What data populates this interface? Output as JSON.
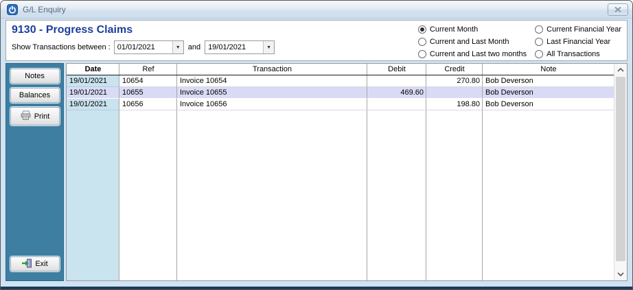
{
  "window": {
    "title": "G/L Enquiry"
  },
  "header": {
    "title": "9130 - Progress Claims"
  },
  "filters": {
    "label": "Show Transactions between :",
    "from_value": "01/01/2021",
    "conjunction": "and",
    "to_value": "19/01/2021",
    "radio_options": [
      {
        "label": "Current Month",
        "selected": true
      },
      {
        "label": "Current and Last Month",
        "selected": false
      },
      {
        "label": "Current and Last two months",
        "selected": false
      },
      {
        "label": "Current Financial Year",
        "selected": false
      },
      {
        "label": "Last Financial Year",
        "selected": false
      },
      {
        "label": "All Transactions",
        "selected": false
      }
    ]
  },
  "sidebar": {
    "buttons": [
      {
        "label": "Notes"
      },
      {
        "label": "Balances"
      },
      {
        "label": "Print"
      },
      {
        "label": "Exit"
      }
    ]
  },
  "table": {
    "headers": [
      "Date",
      "Ref",
      "Transaction",
      "Debit",
      "Credit",
      "Note"
    ],
    "rows": [
      {
        "date": "19/01/2021",
        "ref": "10654",
        "transaction": "Invoice 10654",
        "debit": "",
        "credit": "270.80",
        "note": "Bob Deverson",
        "selected": false
      },
      {
        "date": "19/01/2021",
        "ref": "10655",
        "transaction": "Invoice 10655",
        "debit": "469.60",
        "credit": "",
        "note": "Bob Deverson",
        "selected": true
      },
      {
        "date": "19/01/2021",
        "ref": "10656",
        "transaction": "Invoice 10656",
        "debit": "",
        "credit": "198.80",
        "note": "Bob Deverson",
        "selected": false
      }
    ]
  },
  "icons": {
    "app": "power-icon",
    "close": "close-icon",
    "combo_arrow": "chevron-down-icon",
    "print": "printer-icon",
    "exit": "exit-door-icon",
    "scroll_up": "chevron-up-icon",
    "scroll_down": "chevron-down-icon"
  },
  "colors": {
    "sidebar": "#3e7ea1",
    "date_column": "#c9e3ef",
    "selected_row": "#d9dbf6",
    "page_title": "#1b3e9b",
    "footer_bar": "#1c3a57"
  }
}
